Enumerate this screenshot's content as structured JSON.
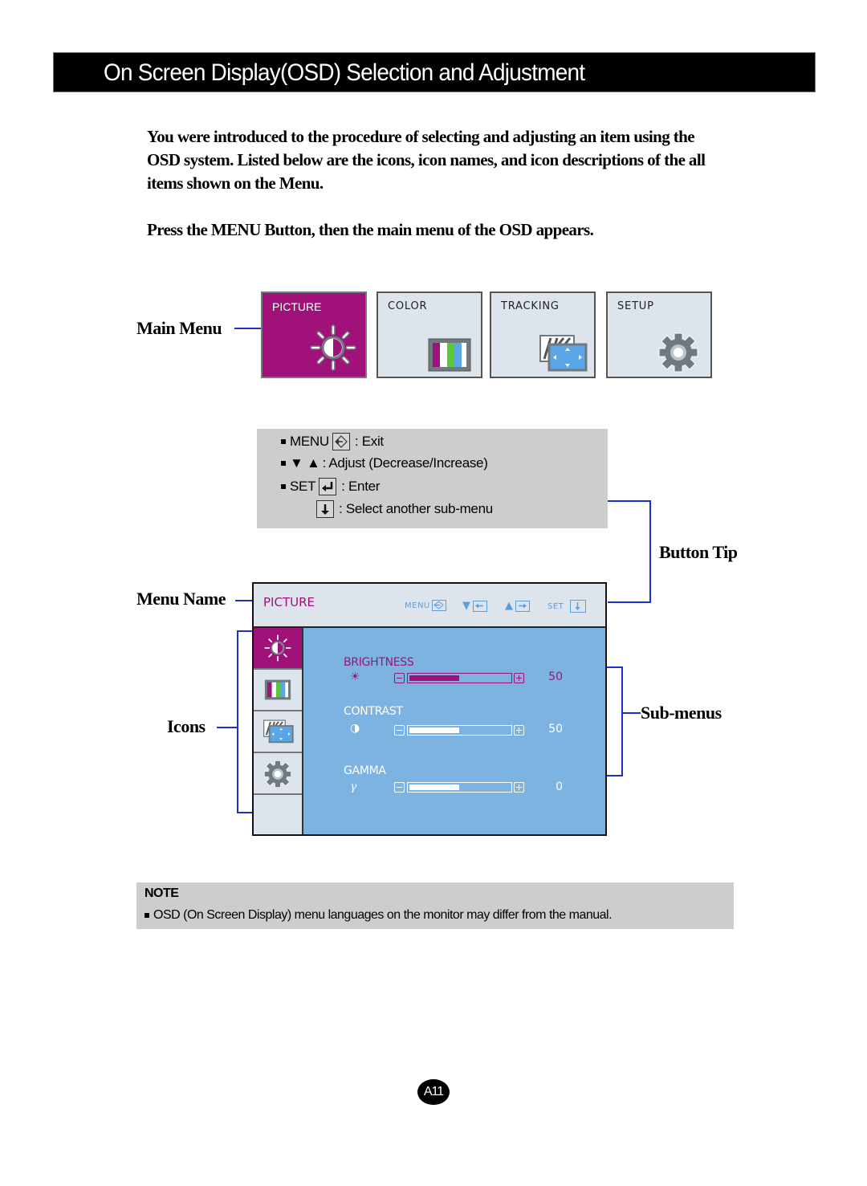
{
  "header": {
    "title": "On Screen Display(OSD) Selection and Adjustment"
  },
  "intro": {
    "paragraph": "You were introduced to the procedure of selecting and adjusting an item using the OSD system.  Listed below are the icons, icon names, and icon descriptions of the all items shown on the Menu.",
    "instruction": "Press the MENU Button, then the main menu of the OSD appears."
  },
  "callouts": {
    "main_menu": "Main Menu",
    "button_tip": "Button Tip",
    "menu_name": "Menu Name",
    "icons": "Icons",
    "sub_menus": "Sub-menus"
  },
  "main_menu": {
    "tiles": [
      {
        "label": "PICTURE",
        "icon": "brightness-icon",
        "active": true
      },
      {
        "label": "COLOR",
        "icon": "color-bars-icon",
        "active": false
      },
      {
        "label": "TRACKING",
        "icon": "tracking-icon",
        "active": false
      },
      {
        "label": "SETUP",
        "icon": "gear-icon",
        "active": false
      }
    ]
  },
  "button_tips": [
    {
      "key": "MENU",
      "icon": "exit-icon",
      "text": ": Exit"
    },
    {
      "key": "",
      "icon": "down-up-triangles-icon",
      "text": ": Adjust (Decrease/Increase)"
    },
    {
      "key": "SET",
      "icon": "enter-icon",
      "text": ": Enter"
    },
    {
      "key": "",
      "icon": "down-arrow-icon",
      "text": ": Select another sub-menu"
    }
  ],
  "osd": {
    "menu_name": "PICTURE",
    "hints": {
      "menu": "MENU",
      "set": "SET"
    },
    "side_icons": [
      "brightness-icon",
      "color-bars-icon",
      "tracking-icon",
      "gear-icon"
    ],
    "submenus": [
      {
        "label": "BRIGHTNESS",
        "symbol": "☀",
        "value": "50",
        "level": 0.5,
        "active": true
      },
      {
        "label": "CONTRAST",
        "symbol": "◑",
        "value": "50",
        "level": 0.5,
        "active": false
      },
      {
        "label": "GAMMA",
        "symbol": "γ",
        "value": "0",
        "level": 0.5,
        "active": false
      }
    ]
  },
  "note": {
    "heading": "NOTE",
    "text": "OSD (On Screen Display) menu languages on the monitor may differ from the manual."
  },
  "page": {
    "number": "A11"
  },
  "colors": {
    "accent": "#a0127a",
    "osd_blue": "#7db3e0",
    "callout_line": "#1c2fd6"
  }
}
